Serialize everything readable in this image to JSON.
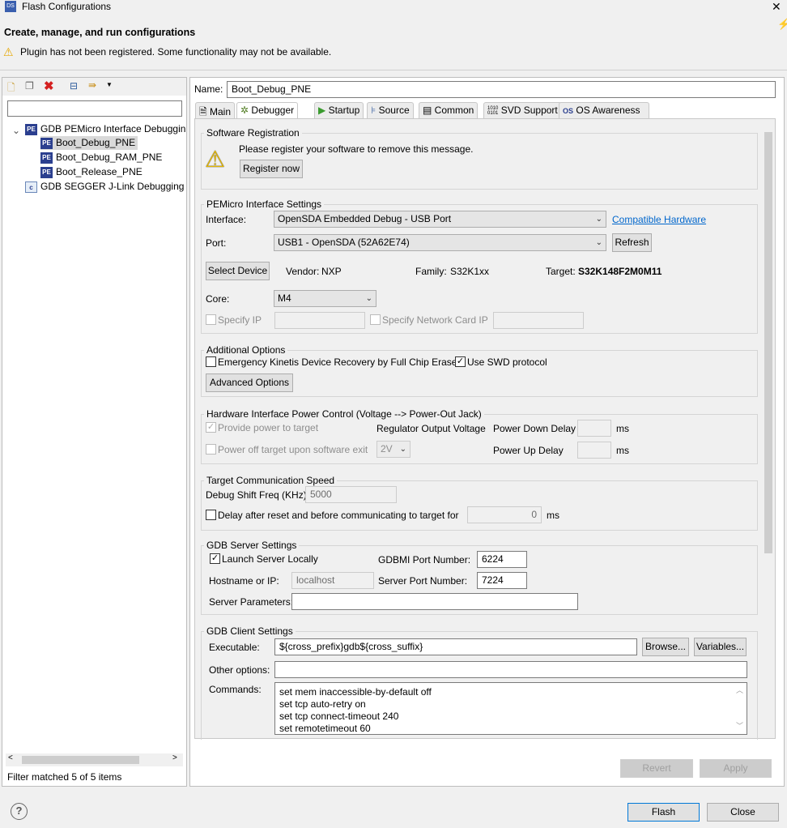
{
  "window": {
    "title": "Flash Configurations",
    "close": "✕"
  },
  "header": {
    "title": "Create, manage, and run configurations",
    "warning": "Plugin has not been registered. Some functionality may not be available."
  },
  "left": {
    "filter_value": "",
    "tree": [
      {
        "label": "GDB PEMicro Interface Debuggin",
        "icon": "pemicro-icon",
        "level": 0,
        "expanded": true
      },
      {
        "label": "Boot_Debug_PNE",
        "icon": "pemicro-icon",
        "level": 1,
        "selected": true
      },
      {
        "label": "Boot_Debug_RAM_PNE",
        "icon": "pemicro-icon",
        "level": 1
      },
      {
        "label": "Boot_Release_PNE",
        "icon": "pemicro-icon",
        "level": 1
      },
      {
        "label": "GDB SEGGER J-Link Debugging",
        "icon": "c-launch-icon",
        "level": 0
      }
    ],
    "status": "Filter matched 5 of 5 items"
  },
  "name": {
    "label": "Name:",
    "value": "Boot_Debug_PNE"
  },
  "tabs": [
    {
      "label": "Main"
    },
    {
      "label": "Debugger",
      "active": true
    },
    {
      "label": "Startup"
    },
    {
      "label": "Source"
    },
    {
      "label": "Common"
    },
    {
      "label": "SVD Support"
    },
    {
      "label": "OS Awareness"
    }
  ],
  "registration": {
    "title": "Software Registration",
    "message": "Please register your software to remove this message.",
    "button": "Register now"
  },
  "pemicro": {
    "title": "PEMicro Interface Settings",
    "interface_label": "Interface:",
    "interface_value": "OpenSDA Embedded Debug - USB Port",
    "compatible_link": "Compatible Hardware",
    "port_label": "Port:",
    "port_value": "USB1 - OpenSDA (52A62E74)",
    "refresh": "Refresh",
    "select_device": "Select Device",
    "vendor_label": "Vendor:",
    "vendor": "NXP",
    "family_label": "Family:",
    "family": "S32K1xx",
    "target_label": "Target:",
    "target": "S32K148F2M0M11",
    "core_label": "Core:",
    "core_value": "M4",
    "specify_ip": "Specify IP",
    "specify_ip_value": "",
    "specify_nic": "Specify Network Card IP",
    "specify_nic_value": ""
  },
  "additional": {
    "title": "Additional Options",
    "emergency": "Emergency Kinetis Device Recovery by Full Chip Erase",
    "emergency_checked": false,
    "swd": "Use SWD protocol",
    "swd_checked": true,
    "advanced": "Advanced Options"
  },
  "power": {
    "title": "Hardware Interface Power Control (Voltage --> Power-Out Jack)",
    "provide": "Provide power to target",
    "provide_checked": true,
    "regulator": "Regulator Output Voltage",
    "down_delay": "Power Down Delay",
    "down_value": "",
    "ms1": "ms",
    "poweroff": "Power off target upon software exit",
    "voltage": "2V",
    "up_delay": "Power Up Delay",
    "up_value": "",
    "ms2": "ms"
  },
  "speed": {
    "title": "Target Communication Speed",
    "freq_label": "Debug Shift Freq (KHz)",
    "freq_value": "5000",
    "delay_label": "Delay after reset and before communicating to target for",
    "delay_value": "0",
    "ms": "ms"
  },
  "server": {
    "title": "GDB Server Settings",
    "launch": "Launch Server Locally",
    "launch_checked": true,
    "gdbmi_label": "GDBMI Port Number:",
    "gdbmi_value": "6224",
    "host_label": "Hostname or IP:",
    "host_value": "localhost",
    "port_label": "Server Port Number:",
    "port_value": "7224",
    "params_label": "Server Parameters:",
    "params_value": ""
  },
  "client": {
    "title": "GDB Client Settings",
    "exec_label": "Executable:",
    "exec_value": "${cross_prefix}gdb${cross_suffix}",
    "browse": "Browse...",
    "variables": "Variables...",
    "other_label": "Other options:",
    "other_value": "",
    "commands_label": "Commands:",
    "commands": [
      "set mem inaccessible-by-default off",
      "set tcp auto-retry on",
      "set tcp connect-timeout 240",
      "set remotetimeout 60"
    ]
  },
  "actions": {
    "revert": "Revert",
    "apply": "Apply"
  },
  "footer": {
    "help": "?",
    "flash": "Flash",
    "close": "Close"
  }
}
